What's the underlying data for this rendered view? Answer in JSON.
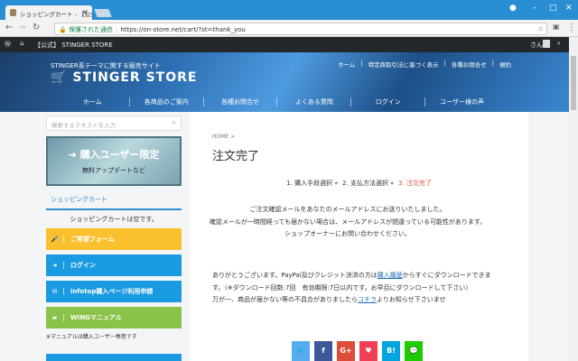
{
  "browser": {
    "tab_title": "ショッピングカート - 【公式】STINGER STORE",
    "secure_label": "保護された通信",
    "url": "https://on-store.net/cart/?st=thank_you"
  },
  "wpbar": {
    "site": "【公式】 STINGER STORE",
    "user": "さん"
  },
  "header": {
    "tagline": "STINGER系テーマに関する販売サイト",
    "logo": "STINGER STORE",
    "top_links": [
      "ホーム",
      "特定商取引法に基づく表示",
      "各種お問合せ",
      "規約"
    ],
    "nav": [
      "ホーム",
      "各商品のご案内",
      "各種お問合せ",
      "よくある質問",
      "ログイン",
      "ユーザー様の声"
    ]
  },
  "sidebar": {
    "search_placeholder": "検索するテキストを入力",
    "banner_title": "購入ユーザー限定",
    "banner_sub": "無料アップデートなど",
    "cart_heading": "ショッピングカート",
    "cart_empty": "ショッピングカートは空です。",
    "buttons": [
      {
        "label": "ご希望フォーム",
        "color": "#fbc02d",
        "icon": "microphone-icon"
      },
      {
        "label": "ログイン",
        "color": "#1a9ae0",
        "icon": "sign-in-icon"
      },
      {
        "label": "infotop購入ページ利用申請",
        "color": "#1a9ae0",
        "icon": "envelope-icon"
      },
      {
        "label": "WINGマニュアル",
        "color": "#8bc34a",
        "icon": "book-icon"
      }
    ],
    "note": "※マニュアルは購入ユーザー専用です"
  },
  "main": {
    "breadcrumb": "HOME >",
    "title": "注文完了",
    "steps": [
      "1. 購入手段選択 »",
      "2. 支払方法選択 »",
      "3. 注文完了"
    ],
    "msg": [
      "ご注文確認メールをあなたのメールアドレスにお送りいたしました。",
      "確認メールが一時間経っても届かない場合は、メールアドレスが間違っている可能性があります。",
      "ショップオーナーにお問い合わせください。"
    ],
    "para1_a": "ありがとうございます。PayPal及びクレジット決済の方は",
    "para1_link": "購入履歴",
    "para1_b": "からすぐにダウンロードできます。（※ダウンロード回数:7回　有効期限:7日以内です。お早目にダウンロードして下さい）",
    "para2_a": "万が一、商品が届かない等の不具合がありましたら",
    "para2_link": "コチラ",
    "para2_b": "よりお知らせ下さいませ",
    "share": [
      {
        "label": "🐦",
        "color": "#55acee",
        "icon": "twitter-icon"
      },
      {
        "label": "f",
        "color": "#3b5998",
        "icon": "facebook-icon"
      },
      {
        "label": "G+",
        "color": "#dd4b39",
        "icon": "google-plus-icon"
      },
      {
        "label": "♥",
        "color": "#ef3f56",
        "icon": "pocket-icon"
      },
      {
        "label": "B!",
        "color": "#00a4de",
        "icon": "hatena-icon"
      },
      {
        "label": "💬",
        "color": "#1dcd00",
        "icon": "line-icon"
      }
    ]
  }
}
